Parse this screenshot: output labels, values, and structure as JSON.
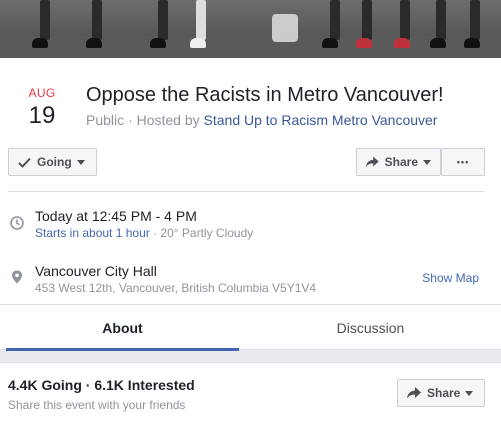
{
  "event": {
    "month": "AUG",
    "day": "19",
    "title": "Oppose the Racists in Metro Vancouver!",
    "privacy": "Public",
    "hosted_prefix": " · Hosted by ",
    "host": "Stand Up to Racism Metro Vancouver"
  },
  "actions": {
    "going_label": "Going",
    "share_label": "Share",
    "more_label": "•••"
  },
  "time": {
    "main": "Today at 12:45 PM - 4 PM",
    "starts": "Starts in about 1 hour",
    "weather": " · 20° Partly Cloudy"
  },
  "location": {
    "name": "Vancouver City Hall",
    "address": "453 West 12th, Vancouver, British Columbia V5Y1V4",
    "show_map": "Show Map"
  },
  "tabs": [
    {
      "label": "About"
    },
    {
      "label": "Discussion"
    }
  ],
  "stats": {
    "counts": "4.4K Going · 6.1K Interested",
    "invite_text": "Share this event with your friends",
    "share_label": "Share"
  },
  "colors": {
    "accent": "#4267b2",
    "date_red": "#e9383f",
    "link": "#385898"
  },
  "icons": {
    "going": "checkmark-icon",
    "share": "share-arrow-icon",
    "time": "clock-icon",
    "location": "map-pin-icon"
  }
}
